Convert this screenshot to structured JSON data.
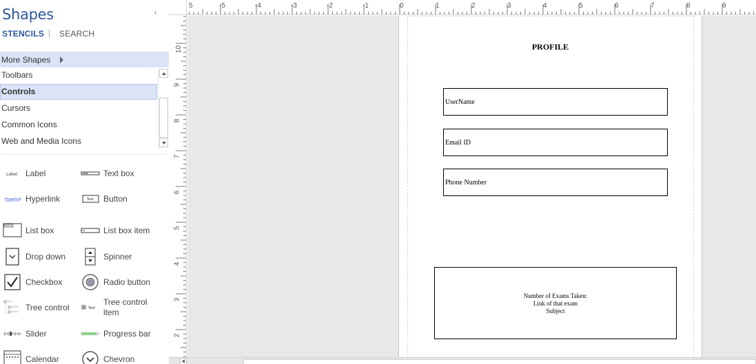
{
  "shapes_pane": {
    "title": "Shapes",
    "collapse_glyph": "‹",
    "tabs": {
      "stencils": "STENCILS",
      "separator": "|",
      "search": "SEARCH"
    },
    "more_shapes": "More Shapes",
    "stencils": [
      {
        "label": "Toolbars",
        "active": false
      },
      {
        "label": "Controls",
        "active": true
      },
      {
        "label": "Cursors",
        "active": false
      },
      {
        "label": "Common Icons",
        "active": false
      },
      {
        "label": "Web and Media Icons",
        "active": false
      }
    ],
    "shapes": [
      {
        "label": "Label",
        "icon": "label-shape-icon"
      },
      {
        "label": "Text box",
        "icon": "text-box-shape-icon"
      },
      {
        "label": "Hyperlink",
        "icon": "hyperlink-shape-icon"
      },
      {
        "label": "Button",
        "icon": "button-shape-icon"
      },
      {
        "label": "List box",
        "icon": "list-box-shape-icon"
      },
      {
        "label": "List box item",
        "icon": "list-box-item-shape-icon"
      },
      {
        "label": "Drop down",
        "icon": "drop-down-shape-icon"
      },
      {
        "label": "Spinner",
        "icon": "spinner-shape-icon"
      },
      {
        "label": "Checkbox",
        "icon": "checkbox-shape-icon"
      },
      {
        "label": "Radio button",
        "icon": "radio-button-shape-icon"
      },
      {
        "label": "Tree control",
        "icon": "tree-control-shape-icon"
      },
      {
        "label": "Tree control item",
        "icon": "tree-control-item-shape-icon"
      },
      {
        "label": "Slider",
        "icon": "slider-shape-icon"
      },
      {
        "label": "Progress bar",
        "icon": "progress-bar-shape-icon"
      },
      {
        "label": "Calendar",
        "icon": "calendar-shape-icon"
      },
      {
        "label": "Chevron",
        "icon": "chevron-shape-icon"
      }
    ],
    "icon_text": {
      "label": "Label",
      "text": "Text",
      "hyperlink": "Hyperlink",
      "listbox": "Default"
    }
  },
  "rulers": {
    "top_labels": [
      "5",
      "-5",
      "-4",
      "-3",
      "-2",
      "-1",
      "0",
      "1",
      "2",
      "3",
      "4",
      "5",
      "6",
      "7",
      "8",
      "9"
    ],
    "left_labels": [
      "10",
      "9",
      "8",
      "7",
      "6",
      "5",
      "4",
      "3",
      "2"
    ]
  },
  "document": {
    "title": "PROFILE",
    "fields": [
      {
        "label": "UserName"
      },
      {
        "label": "Email ID"
      },
      {
        "label": "Phone Number"
      }
    ],
    "exam_box": {
      "line1": "Number of Exams Taken:",
      "line2": "Link of that exam",
      "line3": "Subject"
    }
  },
  "colors": {
    "accent": "#2b579a",
    "selection": "#dbe3f6",
    "canvas_bg": "#e8e8e8"
  }
}
